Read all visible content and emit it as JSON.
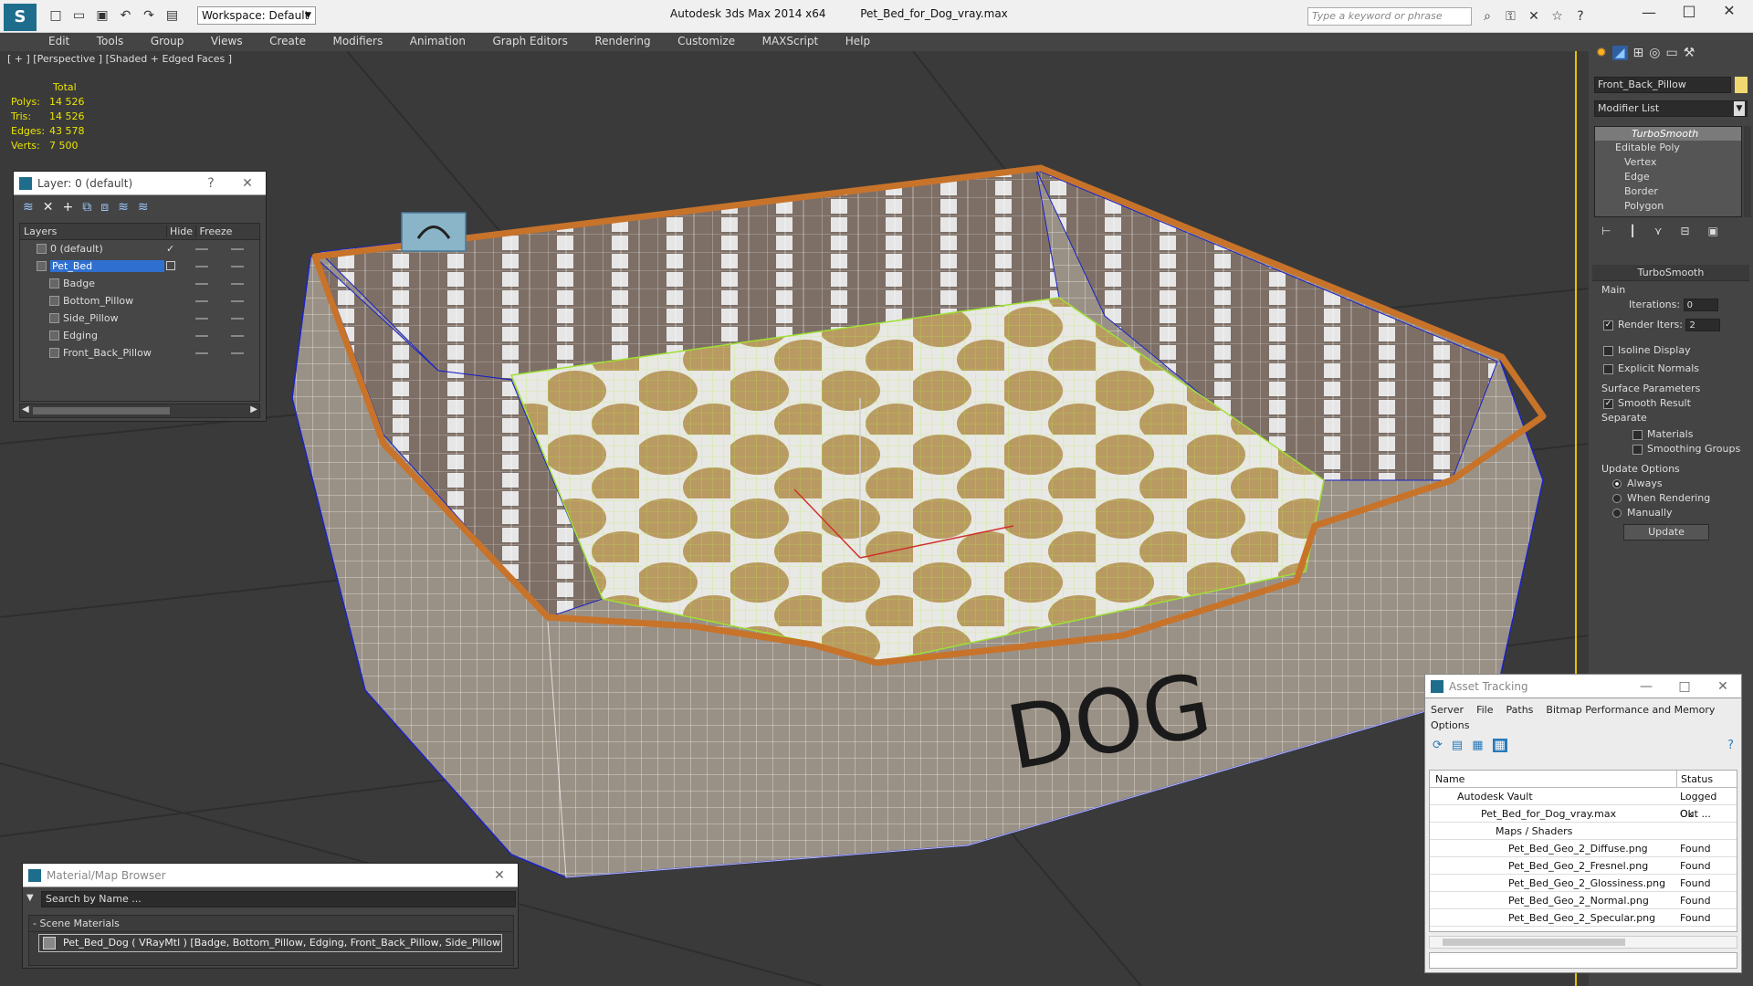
{
  "titlebar": {
    "app": "Autodesk 3ds Max  2014 x64",
    "file": "Pet_Bed_for_Dog_vray.max",
    "workspace": "Workspace: Default",
    "search_placeholder": "Type a keyword or phrase"
  },
  "menu": [
    "Edit",
    "Tools",
    "Group",
    "Views",
    "Create",
    "Modifiers",
    "Animation",
    "Graph Editors",
    "Rendering",
    "Customize",
    "MAXScript",
    "Help"
  ],
  "viewport": {
    "label": "[ + ] [Perspective ] [Shaded + Edged Faces ]",
    "stats": {
      "header": "Total",
      "rows": [
        {
          "label": "Polys:",
          "value": "14 526"
        },
        {
          "label": "Tris:",
          "value": "14 526"
        },
        {
          "label": "Edges:",
          "value": "43 578"
        },
        {
          "label": "Verts:",
          "value": "7 500"
        }
      ]
    },
    "model_text": "DOG"
  },
  "layer_window": {
    "title": "Layer: 0 (default)",
    "help": "?",
    "columns": {
      "layers": "Layers",
      "hide": "Hide",
      "freeze": "Freeze"
    },
    "rows": [
      {
        "name": "0 (default)",
        "indent": 1,
        "selected": false
      },
      {
        "name": "Pet_Bed",
        "indent": 1,
        "selected": true
      },
      {
        "name": "Badge",
        "indent": 2,
        "selected": false
      },
      {
        "name": "Bottom_Pillow",
        "indent": 2,
        "selected": false
      },
      {
        "name": "Side_Pillow",
        "indent": 2,
        "selected": false
      },
      {
        "name": "Edging",
        "indent": 2,
        "selected": false
      },
      {
        "name": "Front_Back_Pillow",
        "indent": 2,
        "selected": false
      }
    ]
  },
  "command_panel": {
    "object_name": "Front_Back_Pillow",
    "modifier_list": "Modifier List",
    "stack": [
      {
        "name": "TurboSmooth",
        "level": 0,
        "active": true
      },
      {
        "name": "Editable Poly",
        "level": 0,
        "active": false
      },
      {
        "name": "Vertex",
        "level": 1,
        "active": false
      },
      {
        "name": "Edge",
        "level": 1,
        "active": false
      },
      {
        "name": "Border",
        "level": 1,
        "active": false
      },
      {
        "name": "Polygon",
        "level": 1,
        "active": false
      }
    ],
    "rollout_title": "TurboSmooth",
    "main_label": "Main",
    "iterations_label": "Iterations:",
    "iterations_value": "0",
    "render_iters_label": "Render Iters:",
    "render_iters_value": "2",
    "isoline": "Isoline Display",
    "explicit_normals": "Explicit Normals",
    "surface_params": "Surface Parameters",
    "smooth_result": "Smooth Result",
    "separate": "Separate",
    "materials": "Materials",
    "smoothing_groups": "Smoothing Groups",
    "update_options": "Update Options",
    "always": "Always",
    "when_rendering": "When Rendering",
    "manually": "Manually",
    "update_button": "Update"
  },
  "asset_tracking": {
    "title": "Asset Tracking",
    "menu": [
      "Server",
      "File",
      "Paths",
      "Bitmap Performance and Memory"
    ],
    "menu2": "Options",
    "col_name": "Name",
    "col_status": "Status",
    "rows": [
      {
        "name": "Autodesk Vault",
        "indent": 1,
        "status": "Logged Out ..."
      },
      {
        "name": "Pet_Bed_for_Dog_vray.max",
        "indent": 2,
        "status": "Ok"
      },
      {
        "name": "Maps / Shaders",
        "indent": 3,
        "status": ""
      },
      {
        "name": "Pet_Bed_Geo_2_Diffuse.png",
        "indent": 4,
        "status": "Found"
      },
      {
        "name": "Pet_Bed_Geo_2_Fresnel.png",
        "indent": 4,
        "status": "Found"
      },
      {
        "name": "Pet_Bed_Geo_2_Glossiness.png",
        "indent": 4,
        "status": "Found"
      },
      {
        "name": "Pet_Bed_Geo_2_Normal.png",
        "indent": 4,
        "status": "Found"
      },
      {
        "name": "Pet_Bed_Geo_2_Specular.png",
        "indent": 4,
        "status": "Found"
      }
    ]
  },
  "material_browser": {
    "title": "Material/Map Browser",
    "search_placeholder": "Search by Name ...",
    "section": "- Scene Materials",
    "item": "Pet_Bed_Dog ( VRayMtl ) [Badge, Bottom_Pillow, Edging, Front_Back_Pillow, Side_Pillow]"
  }
}
